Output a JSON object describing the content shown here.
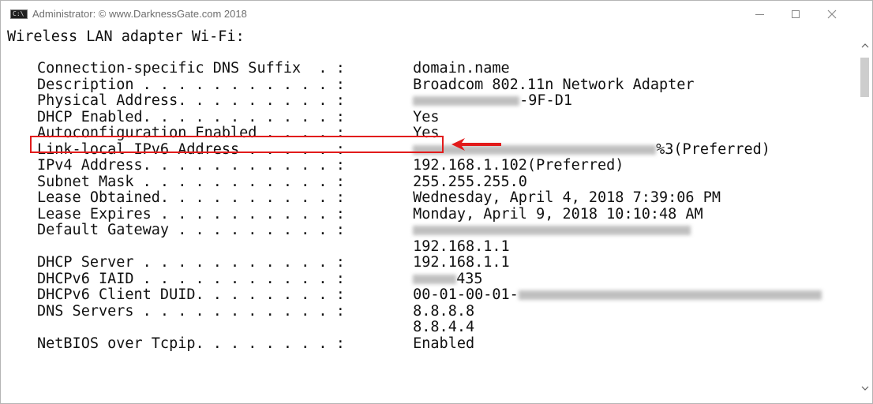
{
  "window": {
    "title": "Administrator: © www.DarknessGate.com 2018",
    "icon_text": "C:\\"
  },
  "console": {
    "header": "Wireless LAN adapter Wi-Fi:",
    "rows": [
      {
        "label": "Connection-specific DNS Suffix  . :",
        "value": " domain.name"
      },
      {
        "label": "Description . . . . . . . . . . . :",
        "value": " Broadcom 802.11n Network Adapter"
      },
      {
        "label": "Physical Address. . . . . . . . . :",
        "value_suffix": "-9F-D1"
      },
      {
        "label": "DHCP Enabled. . . . . . . . . . . :",
        "value": " Yes"
      },
      {
        "label": "Autoconfiguration Enabled . . . . :",
        "value": " Yes"
      },
      {
        "label": "Link-local IPv6 Address . . . . . :",
        "value_suffix": "%3(Preferred)"
      },
      {
        "label": "IPv4 Address. . . . . . . . . . . :",
        "value": " 192.168.1.102(Preferred)"
      },
      {
        "label": "Subnet Mask . . . . . . . . . . . :",
        "value": " 255.255.255.0"
      },
      {
        "label": "Lease Obtained. . . . . . . . . . :",
        "value": " Wednesday, April 4, 2018 7:39:06 PM"
      },
      {
        "label": "Lease Expires . . . . . . . . . . :",
        "value": " Monday, April 9, 2018 10:10:48 AM"
      },
      {
        "label": "Default Gateway . . . . . . . . . :",
        "value": ""
      },
      {
        "label": "",
        "value": "192.168.1.1"
      },
      {
        "label": "DHCP Server . . . . . . . . . . . :",
        "value": " 192.168.1.1"
      },
      {
        "label": "DHCPv6 IAID . . . . . . . . . . . :",
        "value_suffix": "435"
      },
      {
        "label": "DHCPv6 Client DUID. . . . . . . . :",
        "value": " 00-01-00-01-"
      },
      {
        "label": "DNS Servers . . . . . . . . . . . :",
        "value": " 8.8.8.8"
      },
      {
        "label": "",
        "value": "8.8.4.4"
      },
      {
        "label": "NetBIOS over Tcpip. . . . . . . . :",
        "value": " Enabled"
      }
    ]
  },
  "annotation": {
    "highlight_color": "#e21b1b"
  }
}
